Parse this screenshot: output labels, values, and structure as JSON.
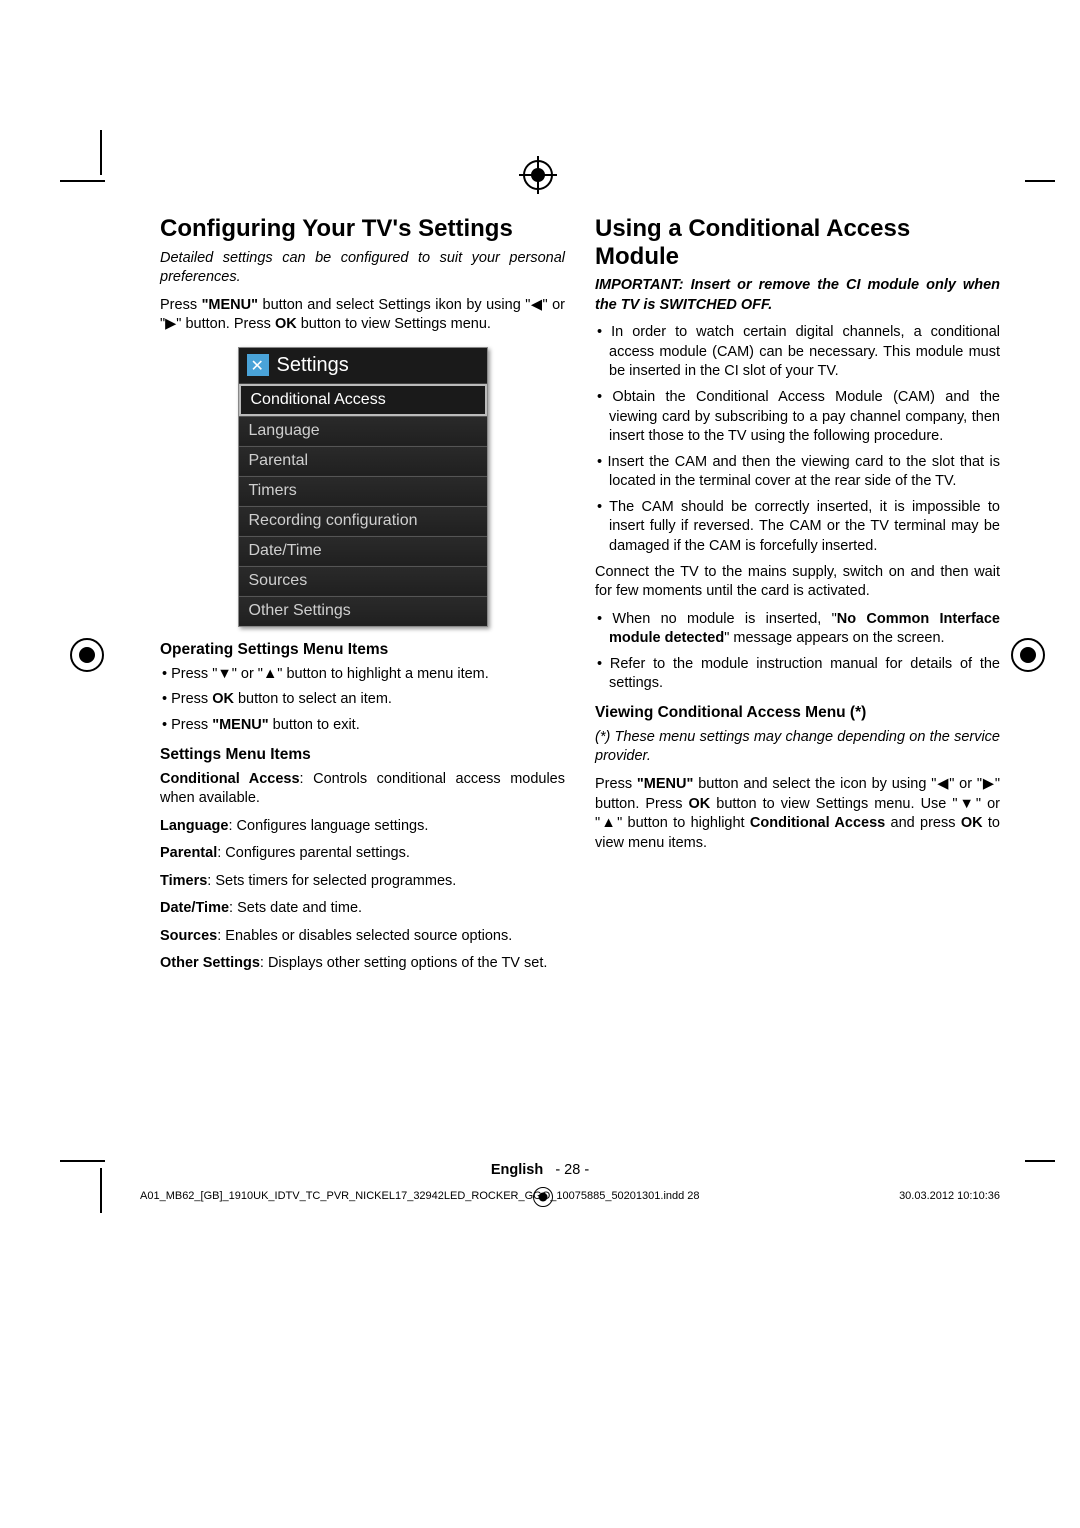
{
  "left": {
    "heading": "Configuring Your TV's Settings",
    "intro": "Detailed settings can be configured to suit your personal preferences.",
    "press_menu_html": "Press <b>\"MENU\"</b> button and select Settings ikon by using \"◀\" or \"▶\" button. Press <b>OK</b> button to view Settings menu.",
    "menu": {
      "title": "Settings",
      "items": [
        "Conditional Access",
        "Language",
        "Parental",
        "Timers",
        "Recording configuration",
        "Date/Time",
        "Sources",
        "Other Settings"
      ],
      "selected_index": 0
    },
    "operating_heading": "Operating Settings Menu Items",
    "op1_html": "Press \"▼\" or \"▲\" button to highlight a menu item.",
    "op2_html": "Press <b>OK</b> button to select an item.",
    "op3_html": "Press <b>\"MENU\"</b> button to exit.",
    "items_heading": "Settings Menu Items",
    "d_conditional_html": "<b>Conditional Access</b>: Controls conditional access modules when available.",
    "d_language_html": "<b>Language</b>: Configures language settings.",
    "d_parental_html": "<b>Parental</b>: Configures parental settings.",
    "d_timers_html": "<b>Timers</b>: Sets timers for selected programmes.",
    "d_datetime_html": "<b>Date/Time</b>: Sets date and time.",
    "d_sources_html": "<b>Sources</b>: Enables or disables selected source options.",
    "d_other_html": "<b>Other Settings</b>: Displays other setting options of the TV set."
  },
  "right": {
    "heading": "Using a Conditional Access Module",
    "important": "IMPORTANT: Insert or remove the CI module only when the TV is SWITCHED OFF.",
    "b1": "In order to watch certain digital channels, a conditional access module (CAM) can be necessary. This module must be inserted in the CI slot of your TV.",
    "b2": "Obtain the Conditional Access Module (CAM) and the viewing card by subscribing to a pay channel company, then insert those to the TV using the following procedure.",
    "b3": "Insert the CAM and then the viewing card to the slot that is located in the terminal cover at the rear side of the TV.",
    "b4": "The CAM should be correctly inserted, it is impossible to insert fully if reversed. The CAM or the TV terminal may be damaged if the CAM is forcefully inserted.",
    "connect": "Connect the TV to the mains supply, switch on and then wait for few moments until the card is activated.",
    "b5_html": "When no module is inserted, \"<b>No Common Interface module detected</b>\" message appears on the screen.",
    "b6": "Refer to the module instruction manual for details of the settings.",
    "view_heading": "Viewing Conditional Access Menu (*)",
    "view_note": "(*) These menu settings may change depending on the service provider.",
    "view_body_html": "Press <b>\"MENU\"</b> button and select the icon by using \"◀\" or \"▶\" button. Press <b>OK</b> button to view Settings menu. Use \"▼\" or \"▲\" button to highlight <b>Conditional Access</b> and press <b>OK</b> to view menu items."
  },
  "footer": {
    "lang": "English",
    "page": "- 28 -",
    "file": "A01_MB62_[GB]_1910UK_IDTV_TC_PVR_NICKEL17_32942LED_ROCKER_GGO_10075885_50201301.indd   28",
    "timestamp": "30.03.2012   10:10:36"
  }
}
